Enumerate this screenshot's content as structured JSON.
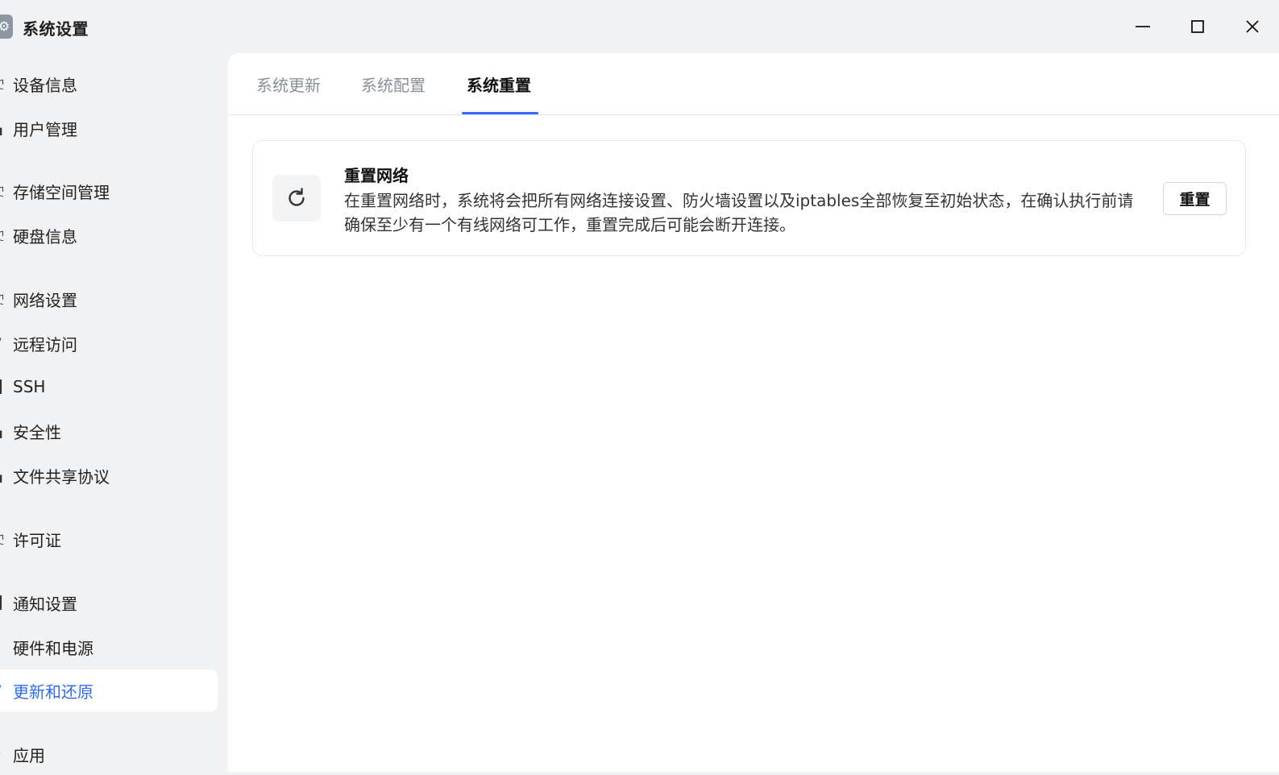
{
  "window": {
    "title": "系统设置",
    "controls": [
      "minimize-icon",
      "maximize-icon",
      "close-icon"
    ]
  },
  "sidebar": {
    "items": [
      {
        "label": "设备信息",
        "icon": "info-icon",
        "active": false
      },
      {
        "label": "用户管理",
        "icon": "user-icon",
        "active": false
      },
      {
        "label": "存储空间管理",
        "icon": "storage-icon",
        "active": false
      },
      {
        "label": "硬盘信息",
        "icon": "disk-icon",
        "active": false
      },
      {
        "label": "网络设置",
        "icon": "network-icon",
        "active": false
      },
      {
        "label": "远程访问",
        "icon": "remote-icon",
        "active": false
      },
      {
        "label": "SSH",
        "icon": "terminal-icon",
        "active": false
      },
      {
        "label": "安全性",
        "icon": "shield-icon",
        "active": false
      },
      {
        "label": "文件共享协议",
        "icon": "share-icon",
        "active": false
      },
      {
        "label": "许可证",
        "icon": "license-icon",
        "active": false
      },
      {
        "label": "通知设置",
        "icon": "bell-icon",
        "active": false
      },
      {
        "label": "硬件和电源",
        "icon": "power-icon",
        "active": false
      },
      {
        "label": "更新和还原",
        "icon": "update-icon",
        "active": true
      },
      {
        "label": "应用",
        "icon": "apps-icon",
        "active": false
      }
    ]
  },
  "tabs": [
    {
      "label": "系统更新",
      "active": false
    },
    {
      "label": "系统配置",
      "active": false
    },
    {
      "label": "系统重置",
      "active": true
    }
  ],
  "reset_network": {
    "icon": "refresh-icon",
    "title": "重置网络",
    "description": "在重置网络时，系统将会把所有网络连接设置、防火墙设置以及iptables全部恢复至初始状态，在确认执行前请确保至少有一个有线网络可工作，重置完成后可能会断开连接。",
    "button_label": "重置"
  },
  "colors": {
    "accent": "#2f6cf5",
    "sidebar_bg": "#f1f2f4",
    "panel_bg": "#ffffff"
  }
}
